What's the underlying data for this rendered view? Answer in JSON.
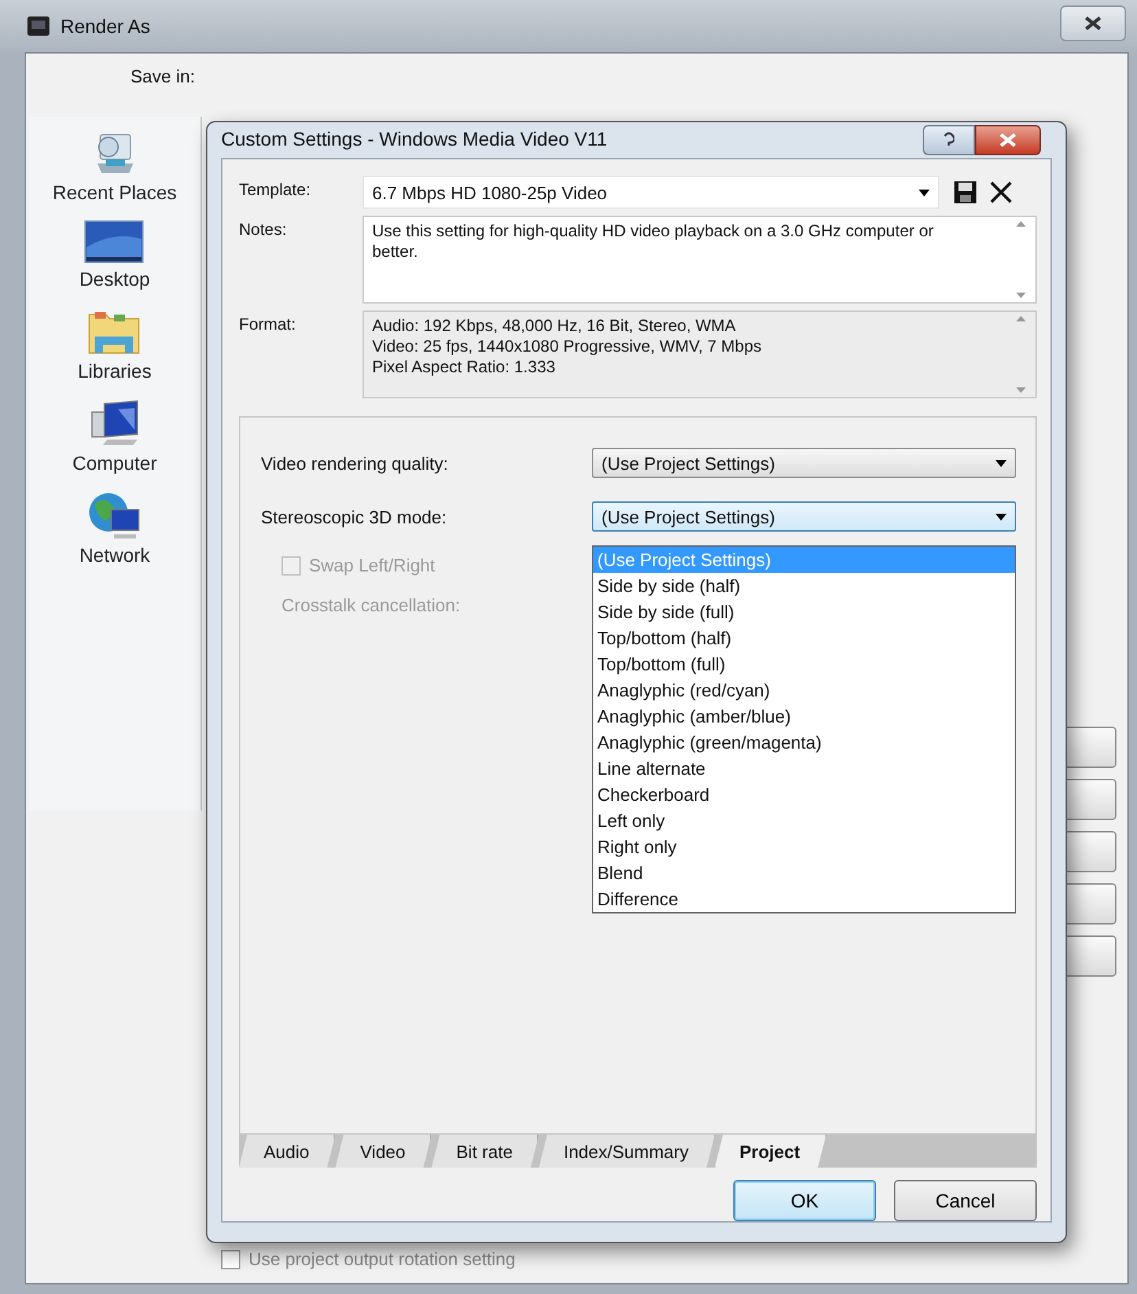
{
  "window": {
    "title": "Render As",
    "save_in_label": "Save in:"
  },
  "places": [
    {
      "label": "Recent Places",
      "kind": "recent"
    },
    {
      "label": "Desktop",
      "kind": "desktop"
    },
    {
      "label": "Libraries",
      "kind": "libraries"
    },
    {
      "label": "Computer",
      "kind": "computer"
    },
    {
      "label": "Network",
      "kind": "network"
    }
  ],
  "rotation_option": {
    "label": "Use project output rotation setting",
    "checked": false
  },
  "dialog": {
    "title": "Custom Settings - Windows Media Video V11",
    "template": {
      "label": "Template:",
      "value": "6.7 Mbps HD 1080-25p Video"
    },
    "notes": {
      "label": "Notes:",
      "value": "Use this setting for high-quality HD video playback on a 3.0 GHz computer or better."
    },
    "format": {
      "label": "Format:",
      "lines": [
        "Audio: 192 Kbps, 48,000 Hz, 16 Bit, Stereo, WMA",
        "Video: 25 fps, 1440x1080 Progressive, WMV, 7 Mbps",
        "Pixel Aspect Ratio: 1.333"
      ]
    },
    "settings": [
      {
        "label": "Video rendering quality:",
        "value": "(Use Project Settings)",
        "expanded": false
      },
      {
        "label": "Stereoscopic 3D mode:",
        "value": "(Use Project Settings)",
        "expanded": true,
        "options": [
          {
            "label": "(Use Project Settings)",
            "selected": true
          },
          {
            "label": "Side by side (half)",
            "selected": false
          },
          {
            "label": "Side by side (full)",
            "selected": false
          },
          {
            "label": "Top/bottom (half)",
            "selected": false
          },
          {
            "label": "Top/bottom (full)",
            "selected": false
          },
          {
            "label": "Anaglyphic (red/cyan)",
            "selected": false
          },
          {
            "label": "Anaglyphic (amber/blue)",
            "selected": false
          },
          {
            "label": "Anaglyphic (green/magenta)",
            "selected": false
          },
          {
            "label": "Line alternate",
            "selected": false
          },
          {
            "label": "Checkerboard",
            "selected": false
          },
          {
            "label": "Left only",
            "selected": false
          },
          {
            "label": "Right only",
            "selected": false
          },
          {
            "label": "Blend",
            "selected": false
          },
          {
            "label": "Difference",
            "selected": false
          }
        ]
      }
    ],
    "swap": {
      "label": "Swap Left/Right",
      "checked": false,
      "disabled": true
    },
    "crosstalk": {
      "label": "Crosstalk cancellation:",
      "disabled": true
    },
    "tabs": [
      {
        "label": "Audio",
        "selected": false
      },
      {
        "label": "Video",
        "selected": false
      },
      {
        "label": "Bit rate",
        "selected": false
      },
      {
        "label": "Index/Summary",
        "selected": false
      },
      {
        "label": "Project",
        "selected": true
      }
    ],
    "buttons": [
      {
        "label": "OK",
        "default": true
      },
      {
        "label": "Cancel",
        "default": false
      }
    ]
  }
}
